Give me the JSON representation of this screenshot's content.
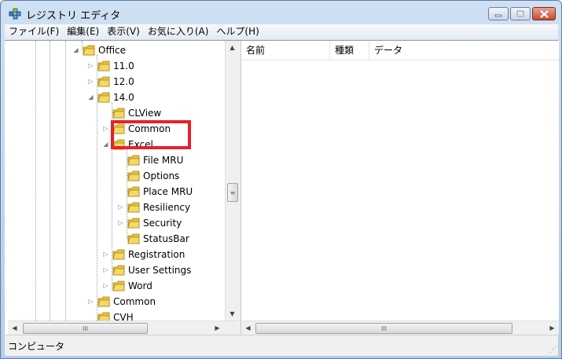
{
  "window": {
    "title": "レジストリ エディタ"
  },
  "menu": [
    "ファイル(F)",
    "編集(E)",
    "表示(V)",
    "お気に入り(A)",
    "ヘルプ(H)"
  ],
  "tree": [
    {
      "label": "Office",
      "expander": "expanded"
    },
    {
      "label": "11.0",
      "expander": "collapsed"
    },
    {
      "label": "12.0",
      "expander": "collapsed"
    },
    {
      "label": "14.0",
      "expander": "expanded"
    },
    {
      "label": "CLView",
      "expander": "none"
    },
    {
      "label": "Common",
      "expander": "collapsed"
    },
    {
      "label": "Excel",
      "expander": "expanded"
    },
    {
      "label": "File MRU",
      "expander": "none"
    },
    {
      "label": "Options",
      "expander": "none",
      "selected": true
    },
    {
      "label": "Place MRU",
      "expander": "none"
    },
    {
      "label": "Resiliency",
      "expander": "collapsed"
    },
    {
      "label": "Security",
      "expander": "collapsed"
    },
    {
      "label": "StatusBar",
      "expander": "none"
    },
    {
      "label": "Registration",
      "expander": "collapsed"
    },
    {
      "label": "User Settings",
      "expander": "collapsed"
    },
    {
      "label": "Word",
      "expander": "collapsed"
    },
    {
      "label": "Common",
      "expander": "collapsed"
    },
    {
      "label": "CVH",
      "expander": "none"
    }
  ],
  "columns": [
    "名前",
    "種類",
    "データ"
  ],
  "status": {
    "path": "コンピュータ"
  },
  "colors": {
    "folder": "#e8c13d",
    "highlight": "#e8202a"
  },
  "icons": {
    "app": "registry-editor-icon",
    "folder": "folder-icon",
    "expanded": "triangle-down-icon",
    "collapsed": "triangle-right-icon"
  }
}
